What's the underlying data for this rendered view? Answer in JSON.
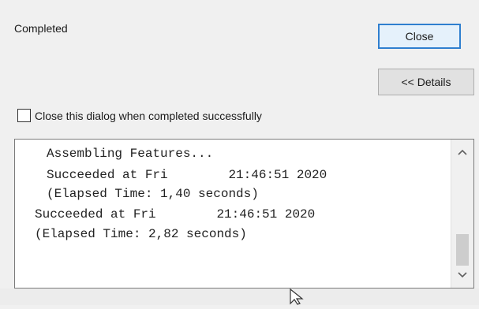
{
  "dialog": {
    "status_text": "Completed",
    "close_label": "Close",
    "details_label": "<< Details",
    "checkbox_label": "Close this dialog when completed successfully",
    "checkbox_checked": false
  },
  "log": {
    "lines": [
      "Assembling Features...",
      "Succeeded at Fri        21:46:51 2020",
      "(Elapsed Time: 1,40 seconds)",
      "Succeeded at Fri        21:46:51 2020",
      "(Elapsed Time: 2,82 seconds)"
    ]
  },
  "scrollbar": {
    "up_icon": "chevron-up-icon",
    "down_icon": "chevron-down-icon"
  },
  "colors": {
    "focus_border": "#2f7fcf",
    "dialog_bg": "#f0f0f0"
  }
}
